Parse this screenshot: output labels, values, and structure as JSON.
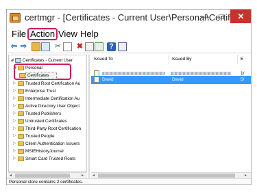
{
  "window": {
    "title": "certmgr - [Certificates - Current User\\Personal\\Certificates]",
    "controls": {
      "minimize": "—",
      "maximize": "□",
      "close": "✕"
    }
  },
  "menu": {
    "file": "File",
    "action": "Action",
    "view": "View",
    "help": "Help"
  },
  "toolbar": {
    "icons": [
      "back-arrow-icon",
      "forward-arrow-icon",
      "up-folder-icon",
      "show-tree-icon",
      "cut-icon",
      "copy-icon",
      "delete-icon",
      "properties-icon",
      "export-list-icon",
      "help-icon",
      "action-pane-icon"
    ],
    "back": "⇦",
    "forward": "⇨",
    "cut": "✂",
    "delete": "✖",
    "help": "?"
  },
  "tree": {
    "root": "Certificates - Current User",
    "personal": "Personal",
    "certificates": "Certificates",
    "items": [
      "Trusted Root Certification Au",
      "Enterprise Trust",
      "Intermediate Certification Au",
      "Active Directory User Object",
      "Trusted Publishers",
      "Untrusted Certificates",
      "Third-Party Root Certification",
      "Trusted People",
      "Client Authentication Issuers",
      "MSIEHistoryJournal",
      "Smart Card Trusted Roots"
    ],
    "expand_glyph": "▷",
    "collapse_glyph": "◢"
  },
  "list": {
    "columns": {
      "issued_to": "Issued To",
      "issued_by": "Issued By",
      "expiration": "E"
    },
    "rows": [
      {
        "issued_to": "",
        "issued_by": "",
        "expiration": "1/"
      },
      {
        "issued_to": "David",
        "issued_by": "David",
        "expiration": "5/"
      }
    ]
  },
  "scrollbar": {
    "left": "◂",
    "right": "▸"
  },
  "status": {
    "text": "Personal store contains 2 certificates."
  },
  "colors": {
    "highlight_ring": "#d11a55",
    "selection": "#3399ff",
    "close_button": "#c7322b",
    "folder": "#e9c25d"
  }
}
